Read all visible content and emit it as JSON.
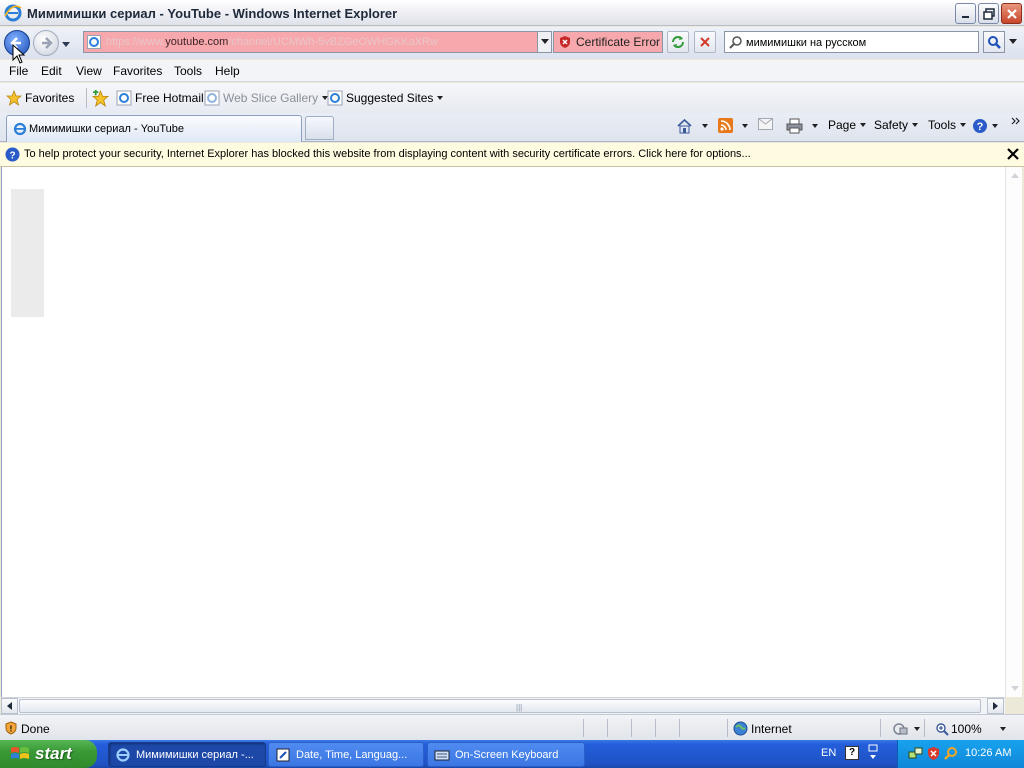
{
  "window": {
    "title": "Мимимишки сериал - YouTube - Windows Internet Explorer"
  },
  "navigation": {
    "url_prefix": "https://www.",
    "url_domain": "youtube.com",
    "url_path": "/channel/UCMWh-5vBZGeOWHGKKaXRw",
    "certificate_error_label": "Certificate Error",
    "search_value": "мимимишки на русском"
  },
  "menu": {
    "file": "File",
    "edit": "Edit",
    "view": "View",
    "favorites": "Favorites",
    "tools": "Tools",
    "help": "Help"
  },
  "favorites_bar": {
    "favorites_label": "Favorites",
    "items": [
      "Free Hotmail",
      "Web Slice Gallery",
      "Suggested Sites"
    ]
  },
  "tabs": {
    "active_tab_label": "Мимимишки сериал - YouTube"
  },
  "command_bar": {
    "page": "Page",
    "safety": "Safety",
    "tools": "Tools"
  },
  "infobar": {
    "message": "To help protect your security, Internet Explorer has blocked this website from displaying content with security certificate errors. Click here for options..."
  },
  "status": {
    "text": "Done",
    "zone": "Internet",
    "zoom": "100%"
  },
  "taskbar": {
    "start_label": "start",
    "items": [
      "Мимимишки сериал -...",
      "Date, Time, Languag...",
      "On-Screen Keyboard"
    ],
    "language": "EN",
    "clock": "10:26 AM"
  },
  "colors": {
    "address_error_bg": "#f7a8ad",
    "infobar_bg": "#fffbe0",
    "taskbar_blue": "#245edb",
    "start_green": "#3a9a36"
  }
}
